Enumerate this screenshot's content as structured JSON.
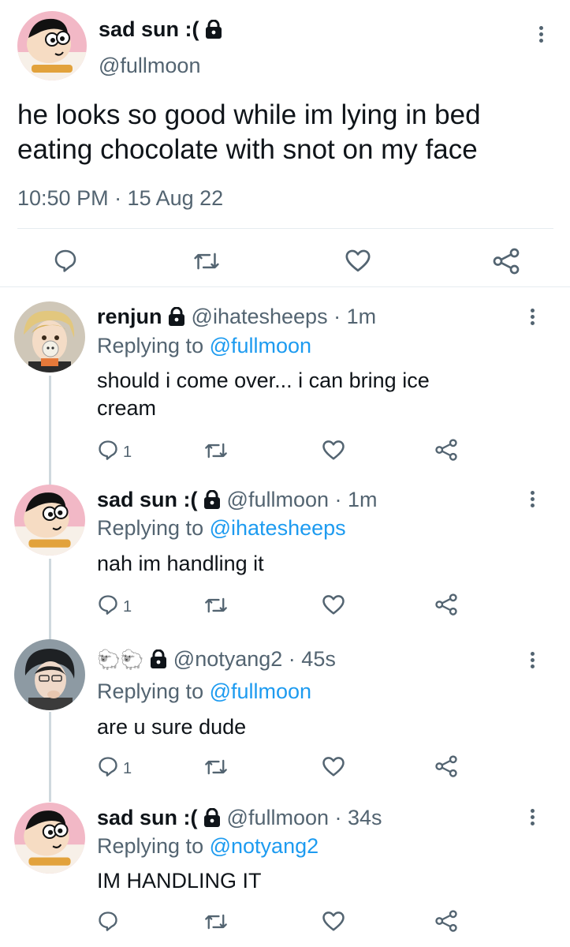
{
  "main_tweet": {
    "display_name": "sad sun :(",
    "handle": "@fullmoon",
    "text_line1": "he looks so good while im lying in bed",
    "text_line2": "eating chocolate with snot on my face",
    "timestamp": "10:50 PM · 15 Aug 22"
  },
  "replies": [
    {
      "display_name": "renjun",
      "handle": "@ihatesheeps · 1m",
      "replying_prefix": "Replying to",
      "replying_to": "@fullmoon",
      "text_line1": "should i come over... i can bring ice",
      "text_line2": "cream",
      "reply_count": "1"
    },
    {
      "display_name": "sad sun :(",
      "handle": "@fullmoon · 1m",
      "replying_prefix": "Replying to",
      "replying_to": "@ihatesheeps",
      "text_line1": "nah im handling it",
      "reply_count": "1"
    },
    {
      "display_name": "🐑🐑",
      "handle": "@notyang2 · 45s",
      "replying_prefix": "Replying to",
      "replying_to": "@fullmoon",
      "text_line1": "are u sure dude",
      "reply_count": "1"
    },
    {
      "display_name": "sad sun :(",
      "handle": "@fullmoon · 34s",
      "replying_prefix": "Replying to",
      "replying_to": "@notyang2",
      "text_line1": "IM HANDLING IT"
    }
  ],
  "icons": {
    "reply": "reply-icon",
    "retweet": "retweet-icon",
    "like": "heart-icon",
    "share": "share-icon",
    "more": "more-options-icon",
    "lock": "lock-icon"
  },
  "colors": {
    "text": "#0f1419",
    "muted": "#536471",
    "link": "#1d9bf0",
    "divider": "#e6ecf0"
  }
}
